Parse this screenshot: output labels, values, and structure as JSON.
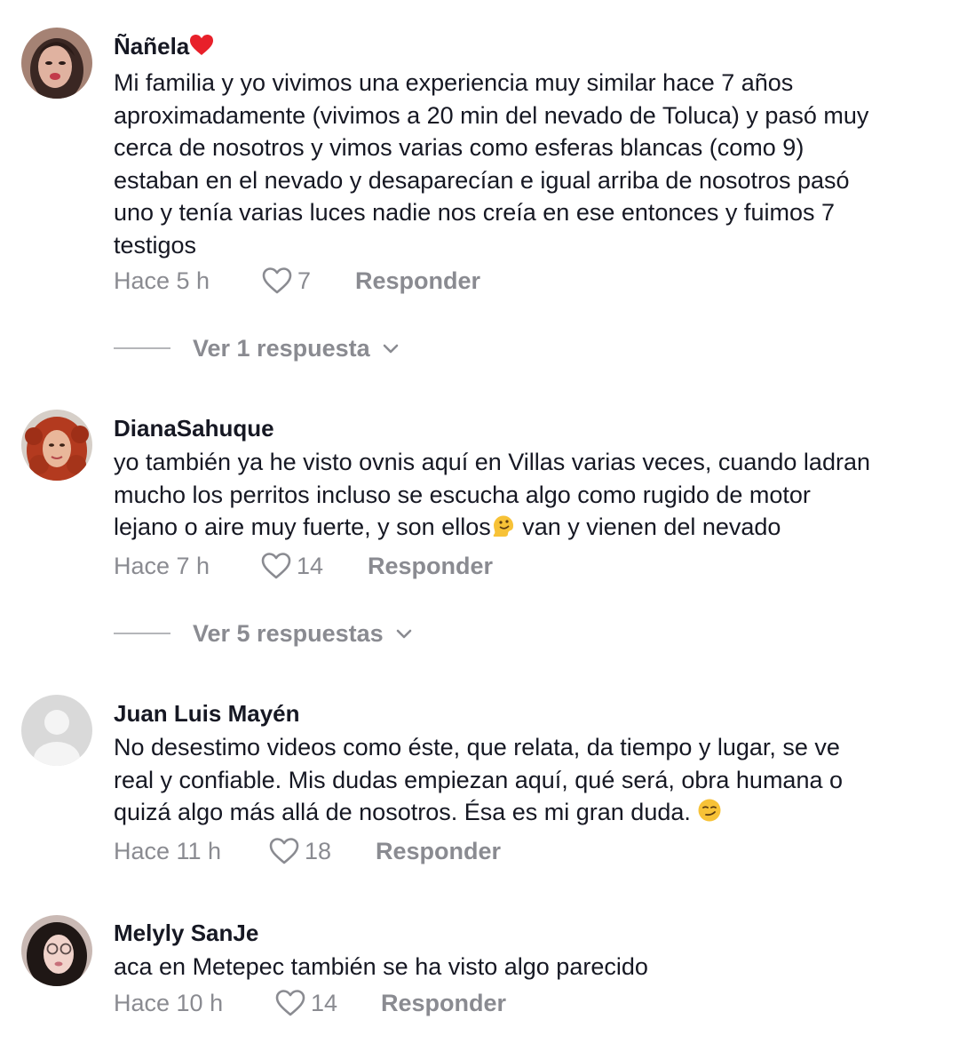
{
  "comments": [
    {
      "username": "Ñañela",
      "text": "Mi familia y yo vivimos una experiencia muy similar hace 7 años\naproximadamente (vivimos a 20 min del nevado de Toluca) y pasó muy\ncerca de nosotros y vimos varias como esferas blancas (como 9)\nestaban en el nevado y desaparecían e igual arriba de nosotros pasó\nuno y tenía varias luces nadie nos creía en ese entonces y fuimos 7\ntestigos",
      "time": "Hace 5 h",
      "likes": "7",
      "reply_label": "Responder",
      "view_replies": "Ver 1 respuesta"
    },
    {
      "username": "DianaSahuque",
      "text": "yo también ya he visto ovnis aquí en Villas varias veces, cuando ladran\nmucho los perritos incluso se escucha algo como rugido de motor\nlejano o aire muy fuerte, y son ellos",
      "text_after_emoji": " van y vienen del nevado",
      "time": "Hace 7 h",
      "likes": "14",
      "reply_label": "Responder",
      "view_replies": "Ver 5 respuestas"
    },
    {
      "username": "Juan Luis Mayén",
      "text": "No desestimo videos como éste, que relata, da tiempo y lugar, se ve\nreal y confiable. Mis dudas empiezan aquí, qué será, obra humana o\nquizá algo más allá de nosotros. Ésa es mi gran duda. ",
      "time": "Hace 11 h",
      "likes": "18",
      "reply_label": "Responder"
    },
    {
      "username": "Melyly SanJe",
      "text": "aca en Metepec también se ha visto algo parecido",
      "time": "Hace 10 h",
      "likes": "14",
      "reply_label": "Responder"
    }
  ],
  "icons": {
    "like": "heart-outline-icon",
    "expand": "chevron-down-icon",
    "heart_emoji": "red-heart-emoji",
    "melting_emoji": "melting-face-emoji",
    "smirk_emoji": "smirking-face-emoji"
  },
  "colors": {
    "text": "#161823",
    "meta": "#8a8b91",
    "heart": "#e8202a"
  }
}
